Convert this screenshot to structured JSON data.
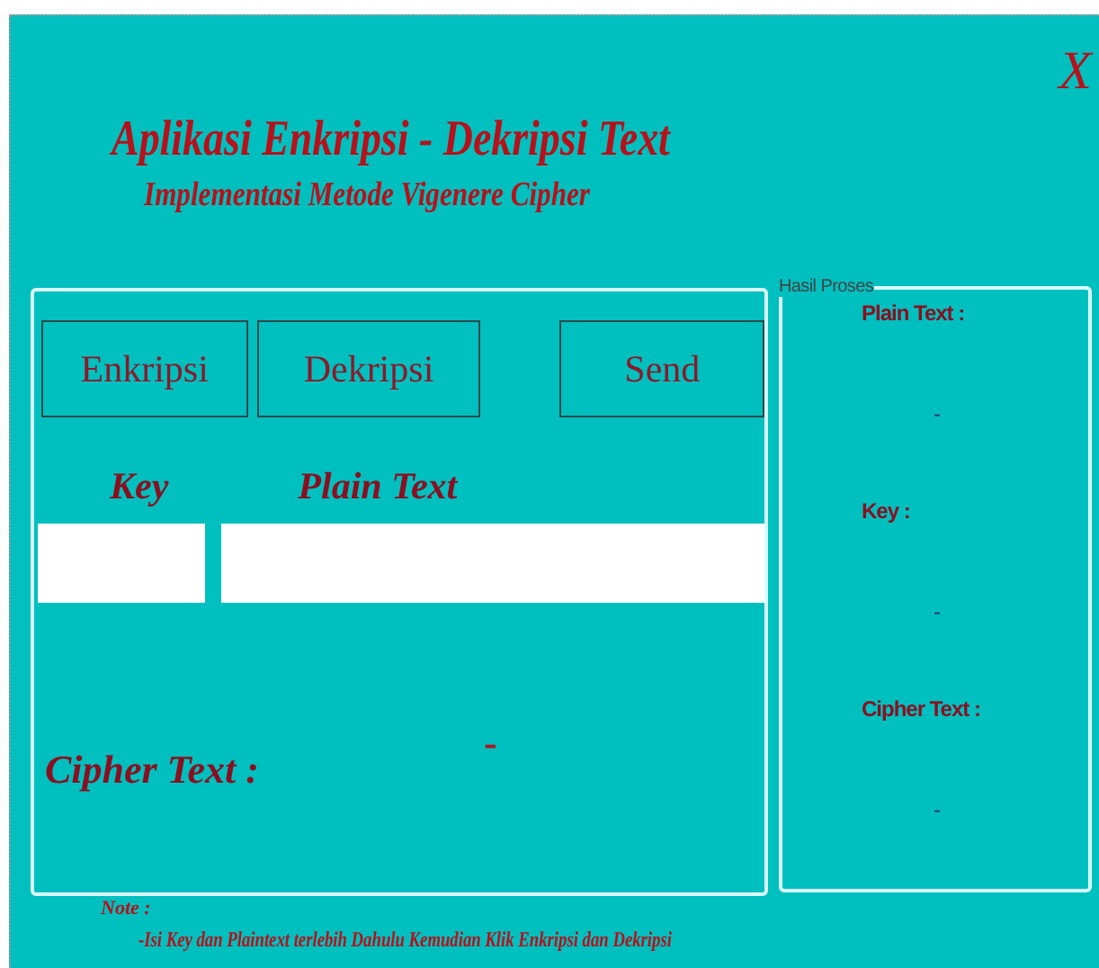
{
  "close_label": "X",
  "title": "Aplikasi Enkripsi - Dekripsi Text",
  "subtitle": "Implementasi Metode Vigenere Cipher",
  "buttons": [
    {
      "label": "Enkripsi"
    },
    {
      "label": "Dekripsi"
    },
    {
      "label": "Send"
    }
  ],
  "inputs": {
    "key_label": "Key",
    "plain_label": "Plain Text"
  },
  "cipher": {
    "label": "Cipher Text :",
    "value": "-"
  },
  "result": {
    "legend": "Hasil Proses",
    "items": [
      {
        "label": "Plain Text :",
        "value": "-"
      },
      {
        "label": "Key :",
        "value": "-"
      },
      {
        "label": "Cipher Text :",
        "value": "-"
      }
    ]
  },
  "note": {
    "legend": "Note :",
    "text": "-Isi Key dan Plaintext terlebih Dahulu Kemudian Klik Enkripsi dan Dekripsi"
  }
}
